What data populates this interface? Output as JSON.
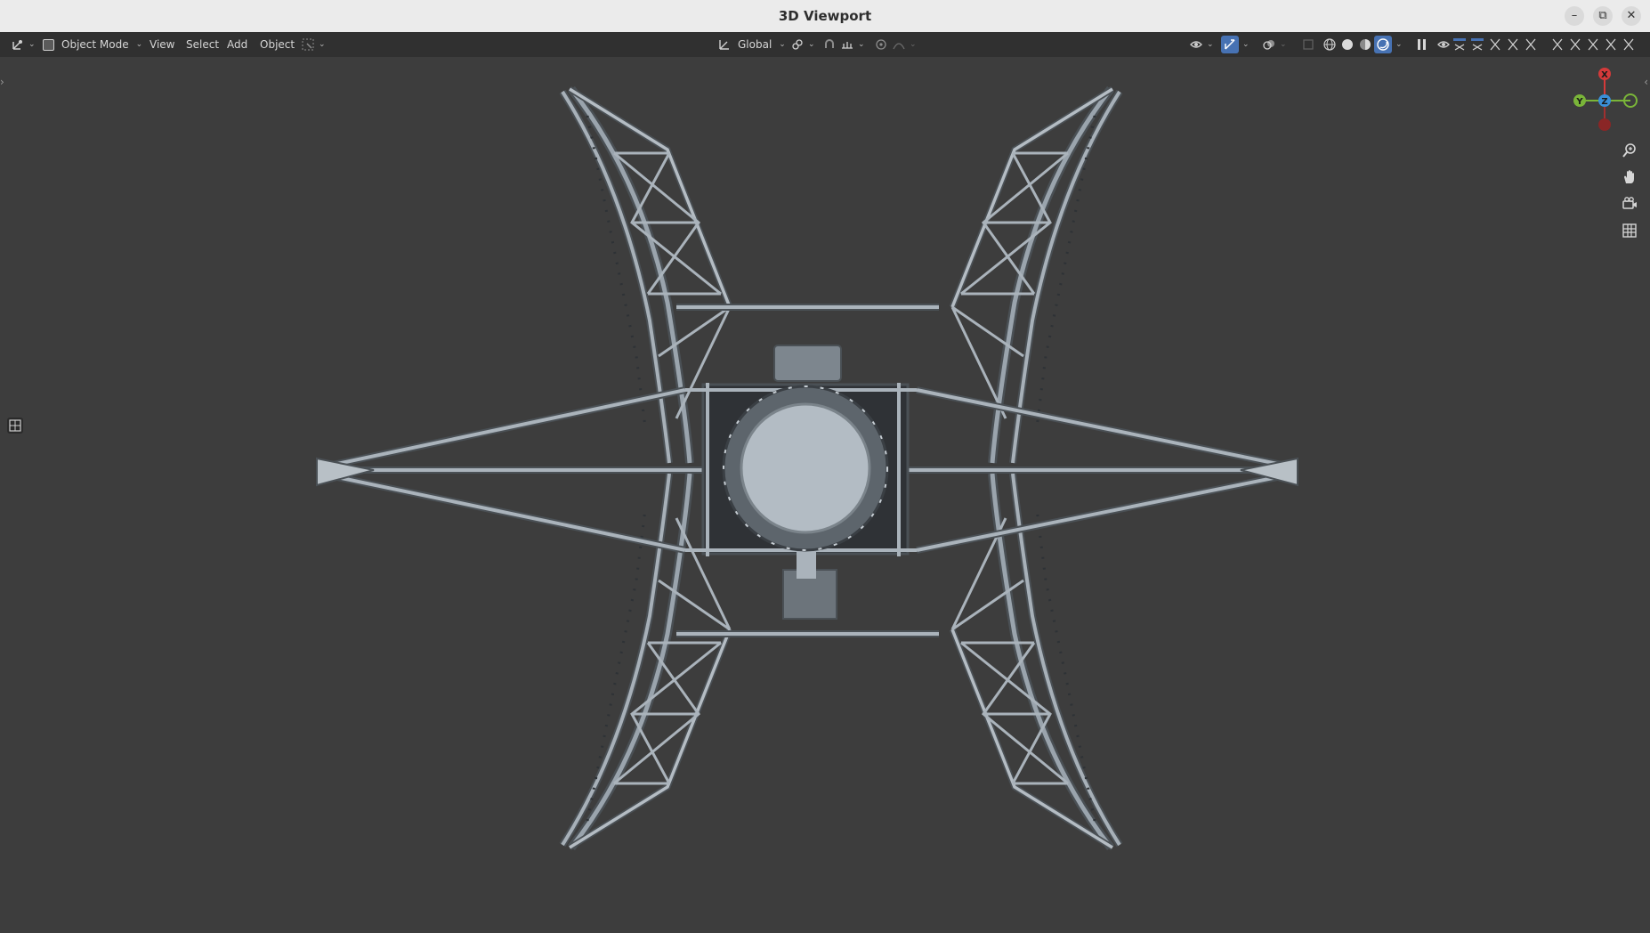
{
  "window": {
    "title": "3D Viewport",
    "controls": [
      "–",
      "⧉",
      "✕"
    ]
  },
  "header": {
    "mode_label": "Object Mode",
    "menus": [
      "View",
      "Select",
      "Add",
      "Object"
    ],
    "transform_orientation": "Global"
  },
  "colors": {
    "viewport_bg": "#3d3d3d",
    "header_bg": "#303030",
    "axis_x": "#d43a3a",
    "axis_y": "#7ab539",
    "axis_z": "#3a8fd9",
    "accent_blue": "#4772b3",
    "model_steel": "#9aa4ad"
  },
  "gizmo": {
    "x_label": "X",
    "y_label": "Y",
    "z_label": "Z"
  },
  "icons": {
    "editor_type": "editor-type-icon",
    "mode": "object-mode-icon",
    "zoom": "zoom-icon",
    "pan": "hand-icon",
    "camera": "camera-icon",
    "ortho": "grid-icon"
  }
}
